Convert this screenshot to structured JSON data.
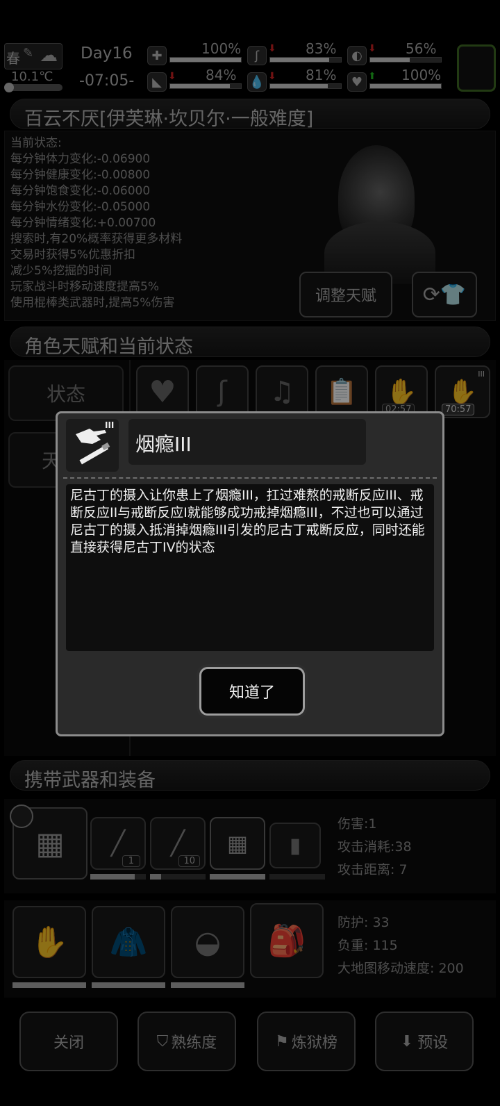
{
  "top": {
    "season": "春",
    "temperature": "10.1℃",
    "day": "Day16",
    "time": "-07:05-",
    "stats": [
      {
        "icon": "medkit-icon",
        "value": "100%",
        "fill": 100
      },
      {
        "icon": "stomach-icon",
        "value": "83%",
        "fill": 83
      },
      {
        "icon": "pill-icon",
        "value": "56%",
        "fill": 56
      },
      {
        "icon": "boot-icon",
        "value": "84%",
        "fill": 84
      },
      {
        "icon": "water-drop-icon",
        "value": "81%",
        "fill": 81
      },
      {
        "icon": "heart-icon",
        "value": "100%",
        "fill": 100
      }
    ]
  },
  "character": {
    "title": "百云不厌[伊芙琳·坎贝尔·一般难度]",
    "status_header": "当前状态:",
    "status_lines": [
      "每分钟体力变化:-0.06900",
      "每分钟健康变化:-0.00800",
      "每分钟饱食变化:-0.06000",
      "每分钟水份变化:-0.05000",
      "每分钟情绪变化:+0.00700",
      "搜索时,有20%概率获得更多材料",
      "交易时获得5%优惠折扣",
      "减少5%挖掘的时间",
      "玩家战斗时移动速度提高5%",
      "使用棍棒类武器时,提高5%伤害"
    ],
    "adjust_talent": "调整天赋"
  },
  "talent_section": {
    "title": "角色天赋和当前状态",
    "tab_status": "状态",
    "tab_talent": "天",
    "timers": [
      "02:57",
      "70:57"
    ],
    "level_badge": "III"
  },
  "equipment": {
    "title": "携带武器和装备",
    "weapon_counts": [
      "1",
      "10"
    ],
    "weapon_stats": [
      "伤害:1",
      "攻击消耗:38",
      "攻击距离: 7"
    ],
    "armor_stats": [
      "防护: 33",
      "负重: 115",
      "大地图移动速度: 200"
    ]
  },
  "bottom_buttons": {
    "close": "关闭",
    "proficiency": "熟练度",
    "ranking": "炼狱榜",
    "preset": "预设"
  },
  "modal": {
    "level": "III",
    "title": "烟瘾III",
    "body": "尼古丁的摄入让你患上了烟瘾III，扛过难熬的戒断反应III、戒断反应II与戒断反应I就能够成功戒掉烟瘾III，不过也可以通过尼古丁的摄入抵消掉烟瘾III引发的尼古丁戒断反应，同时还能直接获得尼古丁IV的状态",
    "ok": "知道了"
  }
}
